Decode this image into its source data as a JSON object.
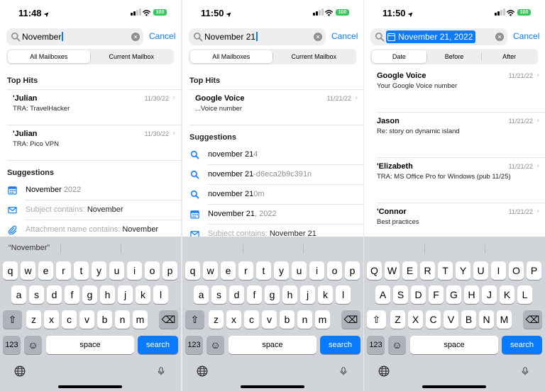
{
  "panels": [
    {
      "time": "11:48",
      "battery": "100",
      "search": {
        "query": "November",
        "token": ""
      },
      "cancel_label": "Cancel",
      "scopes": [
        {
          "label": "All Mailboxes",
          "selected": true
        },
        {
          "label": "Current Mailbox",
          "selected": false
        }
      ],
      "top_hits_heading": "Top Hits",
      "top_hits": [
        {
          "from": "'Julian",
          "subject": "TRA: TravelHacker",
          "date": "11/30/22"
        },
        {
          "from": "'Julian",
          "subject": "TRA: Pico VPN",
          "date": "11/30/22"
        }
      ],
      "suggestions_heading": "Suggestions",
      "suggestions": [
        {
          "icon": "calendar-icon",
          "main": "November",
          "rest": " 2022"
        },
        {
          "icon": "envelope-icon",
          "main": "Subject contains: ",
          "rest": "November"
        },
        {
          "icon": "paperclip-icon",
          "main": "Attachment name contains: ",
          "rest": "November"
        }
      ],
      "quicktype": "“November”"
    },
    {
      "time": "11:50",
      "battery": "100",
      "search": {
        "query": "November 21",
        "token": ""
      },
      "cancel_label": "Cancel",
      "scopes": [
        {
          "label": "All Mailboxes",
          "selected": true
        },
        {
          "label": "Current Mailbox",
          "selected": false
        }
      ],
      "top_hits_heading": "Top Hits",
      "top_hits": [
        {
          "from": "Google Voice",
          "subject": "...Voice number",
          "date": "11/21/22"
        }
      ],
      "suggestions_heading": "Suggestions",
      "suggestions": [
        {
          "icon": "search-icon",
          "main": "november 21",
          "rest": "4"
        },
        {
          "icon": "search-icon",
          "main": "november 21",
          "rest": "-d6eca2b9c391n"
        },
        {
          "icon": "search-icon",
          "main": "november 21",
          "rest": "0m"
        },
        {
          "icon": "calendar-icon",
          "main": "November 21",
          "rest": ", 2022"
        },
        {
          "icon": "envelope-icon",
          "main": "Subject contains: ",
          "rest": "November 21"
        }
      ],
      "quicktype": ""
    },
    {
      "time": "11:50",
      "battery": "100",
      "search": {
        "query": "",
        "token": "November 21, 2022"
      },
      "cancel_label": "Cancel",
      "scopes": [
        {
          "label": "Date",
          "selected": true
        },
        {
          "label": "Before",
          "selected": false
        },
        {
          "label": "After",
          "selected": false
        }
      ],
      "results": [
        {
          "from": "Google Voice",
          "subject": "Your Google Voice number",
          "date": "11/21/22"
        },
        {
          "from": "Jason",
          "subject": "Re: story on dynamic island",
          "date": "11/21/22"
        },
        {
          "from": "'Elizabeth",
          "subject": "TRA: MS Office Pro for Windows (pub 11/25)",
          "date": "11/21/22"
        },
        {
          "from": "'Connor",
          "subject": "Best practices",
          "date": "11/21/22"
        }
      ],
      "quicktype": ""
    }
  ],
  "keyboard": {
    "rows_lower": [
      [
        "q",
        "w",
        "e",
        "r",
        "t",
        "y",
        "u",
        "i",
        "o",
        "p"
      ],
      [
        "a",
        "s",
        "d",
        "f",
        "g",
        "h",
        "j",
        "k",
        "l"
      ],
      [
        "z",
        "x",
        "c",
        "v",
        "b",
        "n",
        "m"
      ]
    ],
    "rows_upper": [
      [
        "Q",
        "W",
        "E",
        "R",
        "T",
        "Y",
        "U",
        "I",
        "O",
        "P"
      ],
      [
        "A",
        "S",
        "D",
        "F",
        "G",
        "H",
        "J",
        "K",
        "L"
      ],
      [
        "Z",
        "X",
        "C",
        "V",
        "B",
        "N",
        "M"
      ]
    ],
    "shift_glyph": "⇧",
    "delete_glyph": "⌫",
    "numbers_label": "123",
    "emoji_glyph": "☺",
    "space_label": "space",
    "search_label": "search"
  },
  "colors": {
    "accent": "#0a7aff",
    "battery": "#34c759",
    "keyboard_bg": "#d1d4d9"
  }
}
